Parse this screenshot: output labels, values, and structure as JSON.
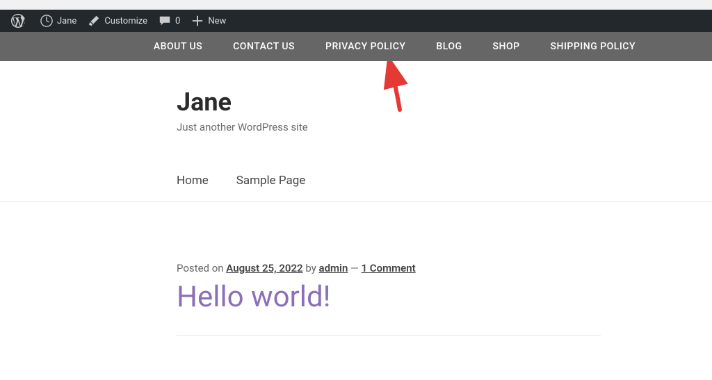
{
  "adminBar": {
    "siteName": "Jane",
    "customize": "Customize",
    "commentCount": "0",
    "newLabel": "New"
  },
  "topNav": {
    "items": [
      "ABOUT US",
      "CONTACT US",
      "PRIVACY POLICY",
      "BLOG",
      "SHOP",
      "SHIPPING POLICY"
    ]
  },
  "header": {
    "siteTitle": "Jane",
    "tagline": "Just another WordPress site"
  },
  "pageNav": {
    "items": [
      "Home",
      "Sample Page"
    ]
  },
  "post": {
    "postedOn": "Posted on ",
    "date": "August 25, 2022",
    "by": " by ",
    "author": "admin",
    "separator": " — ",
    "commentLink": "1 Comment",
    "title": "Hello world!"
  },
  "annotation": {
    "arrowColor": "#e53935"
  }
}
